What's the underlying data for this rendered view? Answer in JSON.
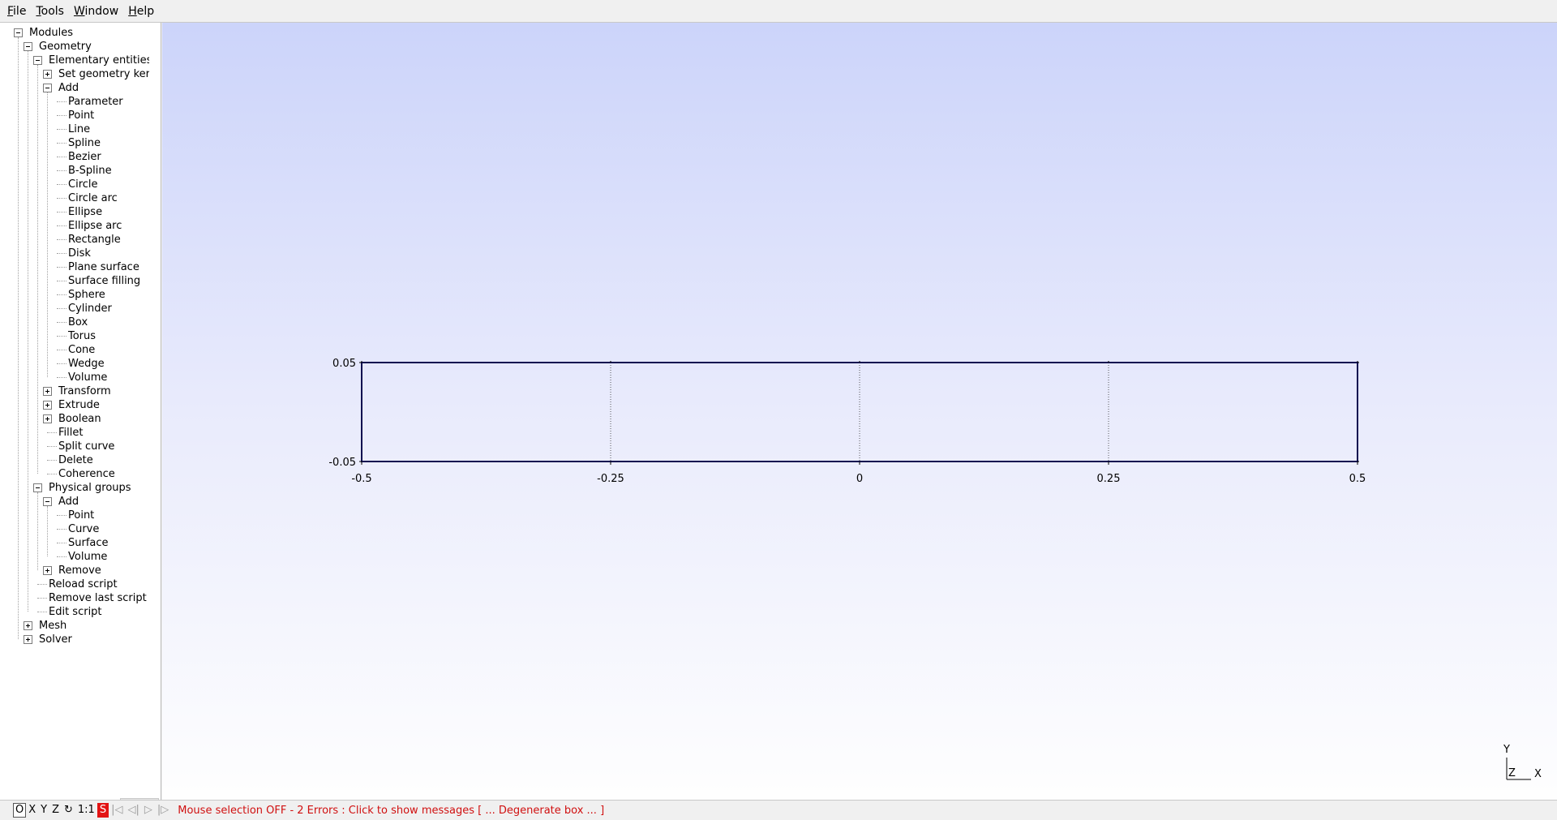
{
  "menu": [
    "File",
    "Tools",
    "Window",
    "Help"
  ],
  "tree": [
    {
      "label": "Modules",
      "level": 0,
      "toggle": "minus"
    },
    {
      "label": "Geometry",
      "level": 1,
      "toggle": "minus"
    },
    {
      "label": "Elementary entities",
      "level": 2,
      "toggle": "minus"
    },
    {
      "label": "Set geometry kerne",
      "level": 3,
      "toggle": "plus"
    },
    {
      "label": "Add",
      "level": 3,
      "toggle": "minus"
    },
    {
      "label": "Parameter",
      "level": 4
    },
    {
      "label": "Point",
      "level": 4
    },
    {
      "label": "Line",
      "level": 4
    },
    {
      "label": "Spline",
      "level": 4
    },
    {
      "label": "Bezier",
      "level": 4
    },
    {
      "label": "B-Spline",
      "level": 4
    },
    {
      "label": "Circle",
      "level": 4
    },
    {
      "label": "Circle arc",
      "level": 4
    },
    {
      "label": "Ellipse",
      "level": 4
    },
    {
      "label": "Ellipse arc",
      "level": 4
    },
    {
      "label": "Rectangle",
      "level": 4
    },
    {
      "label": "Disk",
      "level": 4
    },
    {
      "label": "Plane surface",
      "level": 4
    },
    {
      "label": "Surface filling",
      "level": 4
    },
    {
      "label": "Sphere",
      "level": 4
    },
    {
      "label": "Cylinder",
      "level": 4
    },
    {
      "label": "Box",
      "level": 4
    },
    {
      "label": "Torus",
      "level": 4
    },
    {
      "label": "Cone",
      "level": 4
    },
    {
      "label": "Wedge",
      "level": 4
    },
    {
      "label": "Volume",
      "level": 4
    },
    {
      "label": "Transform",
      "level": 3,
      "toggle": "plus"
    },
    {
      "label": "Extrude",
      "level": 3,
      "toggle": "plus"
    },
    {
      "label": "Boolean",
      "level": 3,
      "toggle": "plus"
    },
    {
      "label": "Fillet",
      "level": 3
    },
    {
      "label": "Split curve",
      "level": 3
    },
    {
      "label": "Delete",
      "level": 3
    },
    {
      "label": "Coherence",
      "level": 3
    },
    {
      "label": "Physical groups",
      "level": 2,
      "toggle": "minus"
    },
    {
      "label": "Add",
      "level": 3,
      "toggle": "minus"
    },
    {
      "label": "Point",
      "level": 4
    },
    {
      "label": "Curve",
      "level": 4
    },
    {
      "label": "Surface",
      "level": 4
    },
    {
      "label": "Volume",
      "level": 4
    },
    {
      "label": "Remove",
      "level": 3,
      "toggle": "plus"
    },
    {
      "label": "Reload script",
      "level": 2
    },
    {
      "label": "Remove last script co",
      "level": 2
    },
    {
      "label": "Edit script",
      "level": 2
    },
    {
      "label": "Mesh",
      "level": 1,
      "toggle": "plus"
    },
    {
      "label": "Solver",
      "level": 1,
      "toggle": "plus"
    }
  ],
  "settings_icon": "gear-icon",
  "plot": {
    "x_ticks": [
      "-0.5",
      "-0.25",
      "0",
      "0.25",
      "0.5"
    ],
    "x_values": [
      -0.5,
      -0.25,
      0,
      0.25,
      0.5
    ],
    "y_ticks": [
      "0.05",
      "-0.05"
    ],
    "y_values": [
      0.05,
      -0.05
    ],
    "xlim": [
      -0.5,
      0.5
    ],
    "ylim": [
      -0.05,
      0.05
    ],
    "outline_color": "#0f0f50"
  },
  "axes_triad": {
    "y": "Y",
    "z": "Z",
    "x": "X"
  },
  "statusbar": {
    "buttons": [
      "O",
      "X",
      "Y",
      "Z",
      "↻",
      "1:1",
      "S",
      "|◁",
      "◁|",
      "▷",
      "|▷"
    ],
    "message": "Mouse selection OFF  -  2 Errors : Click to show messages [ ... Degenerate box ... ]"
  }
}
